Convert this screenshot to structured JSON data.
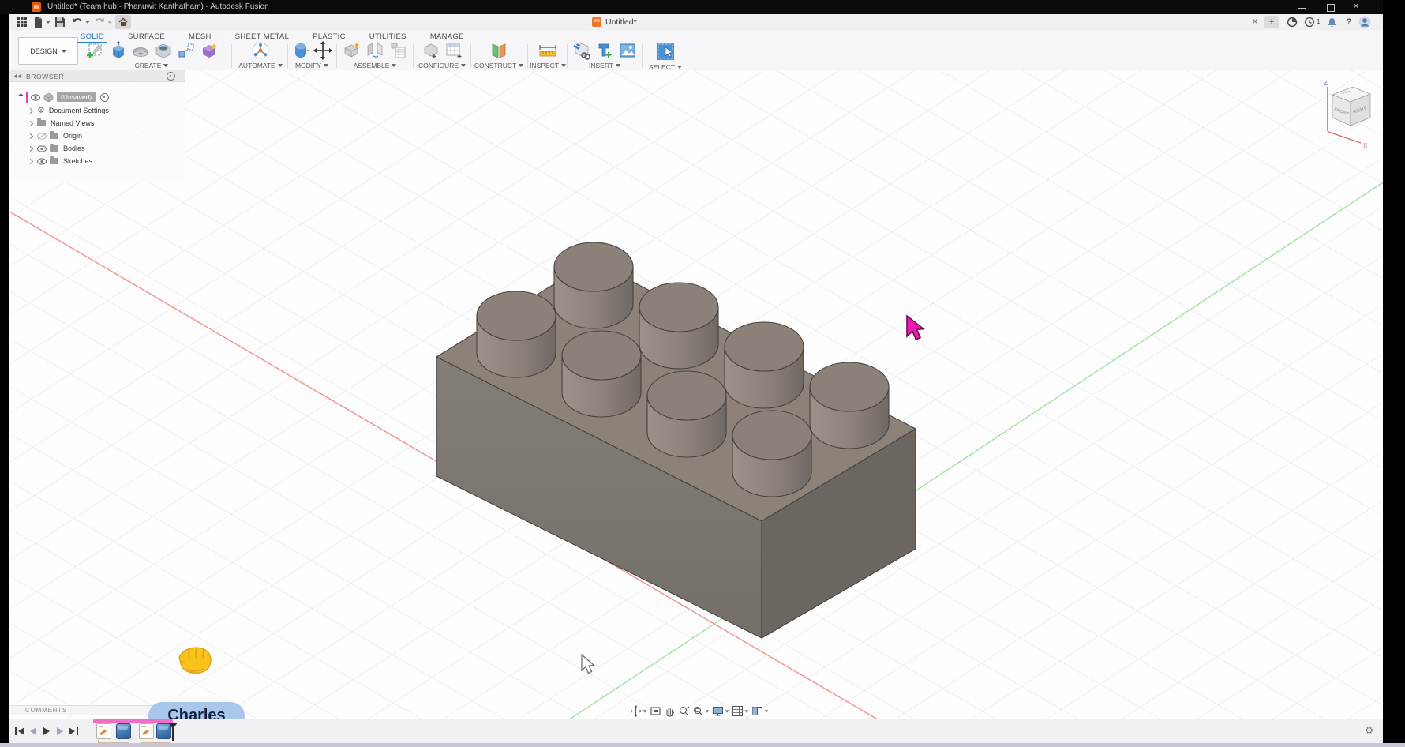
{
  "window": {
    "title": "Untitled* (Team hub - Phanuwit Kanthatham) - Autodesk Fusion"
  },
  "tabstrip": {
    "document_tab": "Untitled*",
    "notification_count": "1"
  },
  "ribbon": {
    "design_menu": "DESIGN",
    "tabs": [
      {
        "label": "SOLID",
        "active": true
      },
      {
        "label": "SURFACE"
      },
      {
        "label": "MESH"
      },
      {
        "label": "SHEET METAL"
      },
      {
        "label": "PLASTIC"
      },
      {
        "label": "UTILITIES"
      },
      {
        "label": "MANAGE"
      }
    ],
    "groups": [
      {
        "label": "CREATE"
      },
      {
        "label": "AUTOMATE"
      },
      {
        "label": "MODIFY"
      },
      {
        "label": "ASSEMBLE"
      },
      {
        "label": "CONFIGURE"
      },
      {
        "label": "CONSTRUCT"
      },
      {
        "label": "INSPECT"
      },
      {
        "label": "INSERT"
      },
      {
        "label": "SELECT"
      }
    ]
  },
  "browser": {
    "header": "BROWSER",
    "root_label": "(Unsaved)",
    "items": [
      {
        "label": "Document Settings"
      },
      {
        "label": "Named Views"
      },
      {
        "label": "Origin"
      },
      {
        "label": "Bodies"
      },
      {
        "label": "Sketches"
      }
    ]
  },
  "viewcube": {
    "faces": {
      "top": "TOP",
      "front": "FRONT",
      "right": "RIGHT"
    },
    "axes": {
      "z": "Z",
      "x": "X"
    }
  },
  "viewport": {
    "model": "lego-brick-2x4",
    "stud_count": 8
  },
  "collaboration": {
    "user": "Charles",
    "reaction": "fist-bump"
  },
  "comments": {
    "header": "COMMENTS"
  },
  "timeline": {
    "features": [
      {
        "type": "sketch"
      },
      {
        "type": "extrude"
      },
      {
        "type": "sketch"
      },
      {
        "type": "extrude"
      }
    ]
  },
  "icons": {
    "close": "✕",
    "plus": "+",
    "help": "?",
    "gear": "⚙"
  },
  "colors": {
    "accent_blue": "#1f74c0",
    "remote_cursor": "#ea1cb3",
    "selection_pink": "#ee6fc6",
    "axis_x": "#f09090",
    "axis_y": "#a6dfa6",
    "brick_top": "#8c8278",
    "brick_front": "#7e7973",
    "brick_right": "#6c6660",
    "titlebar": "#0a0a0a"
  }
}
